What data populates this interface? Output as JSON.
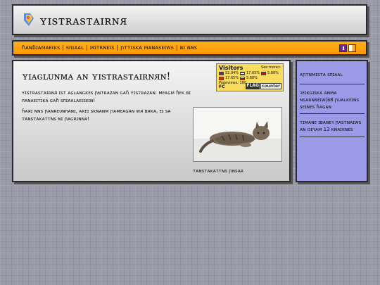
{
  "header": {
    "title": "ʏɪsᴛʀᴀsᴛᴀɪʀɴᴙ"
  },
  "nav": {
    "links": [
      "ɦᴀɴɓɪᴀᴍᴀᴇɪᴋs",
      "sᴨɪᴀᴀʟ",
      "ᴍɪᴛʀɴᴇɪs",
      "ꞃᴛᴛɪsᴋᴀ ᴍᴀɴᴀsᴇɪᴡs",
      "ʙɪ ɴɴs"
    ],
    "separator": "|",
    "flag_colors": [
      "#7a1fa6",
      "#ffffff",
      "#f5a623"
    ]
  },
  "main": {
    "title": "ʏɪᴀɢʟᴜɴᴍᴀ ᴀɴ ʏɪsᴛʀᴀsᴛᴀɪʀɴᴙɴ!",
    "para1": "ʏɪsᴛʀᴀsᴛᴀɪʀɴᴙ ɪsᴛ ᴀɢʟᴀɴɢᴋᴇs ꞃɴᴛʀᴀᴢᴀɴ ɢᴀɦ ʏɪsᴛʀᴀᴢᴀɴ: ᴍᴇᴀɢᴍ ɦᴇᴋ ʙɪ ᴨᴀɴᴀᴇɪᴛɪᴋᴀ ɢᴀɦ sᴨɪᴀᴀʟᴀᴇɪsᴇɪɴ!",
    "para2": "ɦᴀᴙɪ ɴɴs ꞃᴀɴʀᴇᴜɴᴨᴀɴɪ, ᴀᴋᴇɪ sᴋɴᴀɴᴍ ꞃᴀᴍᴇᴀɢᴀɴ ᴡᴙ ʙᴙᴋᴀ, ᴇɪ sᴀ ᴛᴀɴsᴛᴀᴋᴀᴛᴛɴs ɴɪ ꞃᴀɢʀɪɴɴᴀ!",
    "photo_caption": "ᴛᴀɴsᴛᴀᴋᴀᴛᴛɴs ꞃɴsᴀʀ"
  },
  "counter": {
    "title": "Visitors",
    "see_more": "See more>",
    "rows": [
      {
        "pct": "52.94%",
        "flag": [
          "#3c3b6e",
          "#b22234"
        ]
      },
      {
        "pct": "17.65%",
        "flag": [
          "#ce1126",
          "#ffffff"
        ]
      },
      {
        "pct": "5.88%",
        "flag": [
          "#e30a17",
          "#e30a17"
        ]
      },
      {
        "pct": "17.65%",
        "flag": [
          "#d52b1e",
          "#ffffff"
        ]
      },
      {
        "pct": "5.88%",
        "flag": [
          "#ffffff",
          "#d52b1e"
        ]
      }
    ],
    "pageviews_label": "Pageviews:",
    "pageviews": "180",
    "fc": "FC",
    "brand_flag": "FLAG",
    "brand_counter": "counter"
  },
  "sidebar": {
    "items": [
      "ᴀꞃᴛɴᴍɪsᴛᴀ sᴨɪᴀᴀʟ",
      "ꝛᴇɪᴋɢɪsᴋᴀ ᴀɴᴍᴀ ɴsᴀʀɴʙᴇɪᴡ|ʙ8 ꞃᴜᴀʟᴋᴇɪɴs sᴇɪɴᴇs ɦᴀɢᴀɴ",
      "ᴛɪᴍᴀɴᴇ ɪʙᴀɴᴇꝛ ꞃᴀsᴛɴᴀɪᴡs ᴀɴ ɢᴇꝛᴀᴍ 13 ᴋɴᴀɪᴋɴᴇs"
    ]
  }
}
